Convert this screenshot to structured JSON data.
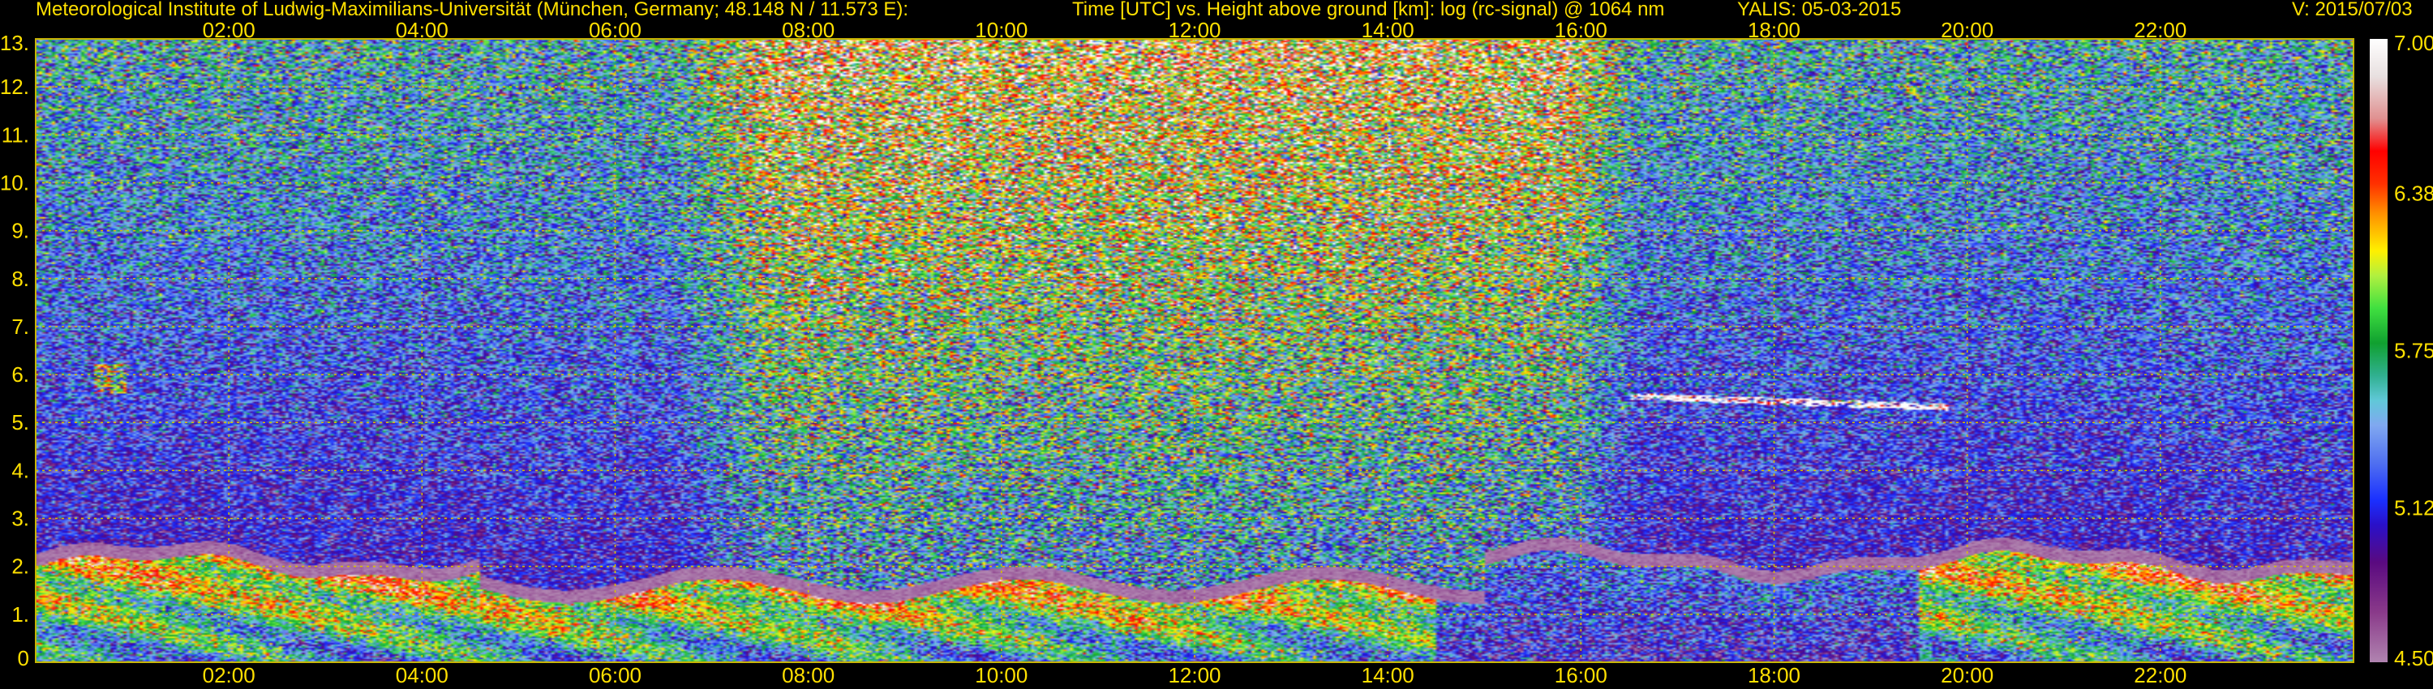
{
  "header": {
    "institute": "Meteorological Institute of Ludwig-Maximilians-Universität (München, Germany; 48.148 N / 11.573 E):",
    "title": "Time [UTC] vs. Height above ground [km]: log (rc-signal) @ 1064 nm",
    "instrument": "YALIS: 05-03-2015",
    "version": "V: 2015/07/03"
  },
  "colors": {
    "background": "#000000",
    "text": "#ffe000",
    "grid": "#d8c000",
    "axis_frame": "#c8b400"
  },
  "chart_data": {
    "type": "heatmap",
    "title": "Time [UTC] vs. Height above ground [km]: log (rc-signal) @ 1064 nm",
    "x_axis": {
      "unit": "UTC",
      "range": [
        "00:00",
        "24:00"
      ],
      "tick_labels": [
        "02:00",
        "04:00",
        "06:00",
        "08:00",
        "10:00",
        "12:00",
        "14:00",
        "16:00",
        "18:00",
        "20:00",
        "22:00"
      ],
      "tick_hours": [
        2,
        4,
        6,
        8,
        10,
        12,
        14,
        16,
        18,
        20,
        22
      ]
    },
    "y_axis": {
      "unit": "km",
      "range": [
        0,
        13
      ],
      "tick_labels": [
        "0",
        "1.",
        "2.",
        "3.",
        "4.",
        "5.",
        "6.",
        "7.",
        "8.",
        "9.",
        "10.",
        "11.",
        "12.",
        "13."
      ],
      "tick_values": [
        0,
        1,
        2,
        3,
        4,
        5,
        6,
        7,
        8,
        9,
        10,
        11,
        12,
        13
      ]
    },
    "grid": true,
    "colorbar": {
      "range": [
        4.5,
        7.0
      ],
      "tick_labels": [
        "7.00",
        "6.38",
        "5.75",
        "5.12",
        "4.50"
      ],
      "tick_values": [
        7.0,
        6.38,
        5.75,
        5.12,
        4.5
      ],
      "stops": [
        {
          "v": 4.5,
          "c": "#b084b0"
        },
        {
          "v": 4.7,
          "c": "#8a3a8a"
        },
        {
          "v": 4.9,
          "c": "#5a0a80"
        },
        {
          "v": 5.05,
          "c": "#2a10c8"
        },
        {
          "v": 5.15,
          "c": "#1a30ff"
        },
        {
          "v": 5.3,
          "c": "#5070f0"
        },
        {
          "v": 5.45,
          "c": "#80a8f0"
        },
        {
          "v": 5.55,
          "c": "#60c8d8"
        },
        {
          "v": 5.65,
          "c": "#30b090"
        },
        {
          "v": 5.78,
          "c": "#10a030"
        },
        {
          "v": 5.92,
          "c": "#40e040"
        },
        {
          "v": 6.05,
          "c": "#b0f040"
        },
        {
          "v": 6.15,
          "c": "#fff000"
        },
        {
          "v": 6.3,
          "c": "#ff9000"
        },
        {
          "v": 6.42,
          "c": "#ff3000"
        },
        {
          "v": 6.55,
          "c": "#ff0000"
        },
        {
          "v": 6.68,
          "c": "#e09090"
        },
        {
          "v": 6.85,
          "c": "#e8e0e0"
        },
        {
          "v": 7.0,
          "c": "#ffffff"
        }
      ]
    }
  }
}
